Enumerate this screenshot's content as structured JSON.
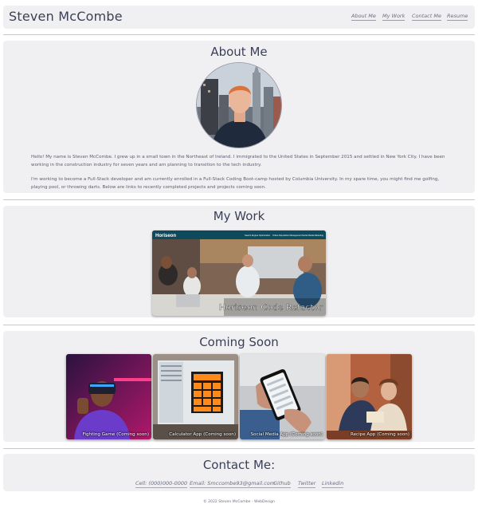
{
  "header": {
    "title": "Steven McCombe",
    "nav": [
      "About Me",
      "My Work",
      "Contact Me",
      "Resume"
    ]
  },
  "about": {
    "heading": "About Me",
    "paragraphs": [
      "Hello! My name is Steven McCombe. I grew up in a small town in the Northeast of Ireland. I immigrated to the United States in September 2015 and settled in New York City. I have been working in the construction industry for seven years and am planning to transition to the tech industry.",
      "I'm working to become a Full-Stack developer and am currently enrolled in a Full-Stack Coding Boot-camp hosted by Columbia University. In my spare time, you might find me golfing, playing pool, or throwing darts. Below are links to recently completed projects and projects coming soon."
    ]
  },
  "work": {
    "heading": "My Work",
    "project": {
      "caption": "Horiseon Code Refactor",
      "screenshot_logo": "Horiseon",
      "screenshot_nav": [
        "Search Engine Optimization",
        "Online Reputation Management",
        "Social Media Marketing"
      ]
    }
  },
  "soon": {
    "heading": "Coming Soon",
    "items": [
      "Fighting Game (Coming soon)",
      "Calculator App (Coming soon)",
      "Social Media App (Coming soon)",
      "Recipe App (Coming soon)"
    ]
  },
  "contact": {
    "heading": "Contact Me:",
    "links": [
      "Cell: (000)000-0000",
      "Email: Smccombe93@gmail.com",
      "Github",
      "Twitter",
      "Linkedin"
    ]
  },
  "footer": {
    "text": "© 2022 Steven McCombe - WebDesign"
  },
  "colors": {
    "panel": "#f0f0f3",
    "text": "#3b3f56",
    "link": "#6b6e80",
    "horiseon_bar": "#0c4a5c"
  }
}
